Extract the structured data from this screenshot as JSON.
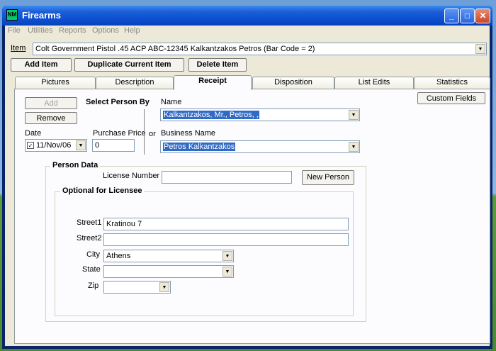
{
  "window": {
    "title": "Firearms",
    "icon_text": "NM"
  },
  "menu": [
    "File",
    "Utilities",
    "Reports",
    "Options",
    "Help"
  ],
  "item": {
    "label": "Item",
    "value": "Colt Government Pistol .45 ACP ABC-12345 Kalkantzakos Petros (Bar Code = 2)"
  },
  "toolbar": {
    "add": "Add Item",
    "duplicate": "Duplicate Current Item",
    "delete": "Delete Item"
  },
  "tabs": [
    "Pictures",
    "Description",
    "Receipt",
    "Disposition",
    "List Edits",
    "Statistics"
  ],
  "receipt": {
    "add_button": "Add",
    "remove_button": "Remove",
    "select_person_by": "Select Person By",
    "name_label": "Name",
    "name_value": "Kalkantzakos, Mr., Petros, ,",
    "date_label": "Date",
    "date_value": "11/Nov/06",
    "purchase_price_label": "Purchase Price",
    "purchase_price_value": "0",
    "or_label": "or",
    "business_name_label": "Business Name",
    "business_name_value": "Petros Kalkantzakos",
    "custom_fields_button": "Custom Fields"
  },
  "person": {
    "title": "Person Data",
    "license_label": "License Number",
    "license_value": "",
    "new_person_button": "New Person",
    "optional_title": "Optional for Licensee",
    "street1_label": "Street1",
    "street1_value": "Kratinou 7",
    "street2_label": "Street2",
    "street2_value": "",
    "city_label": "City",
    "city_value": "Athens",
    "state_label": "State",
    "state_value": "",
    "zip_label": "Zip",
    "zip_value": ""
  }
}
